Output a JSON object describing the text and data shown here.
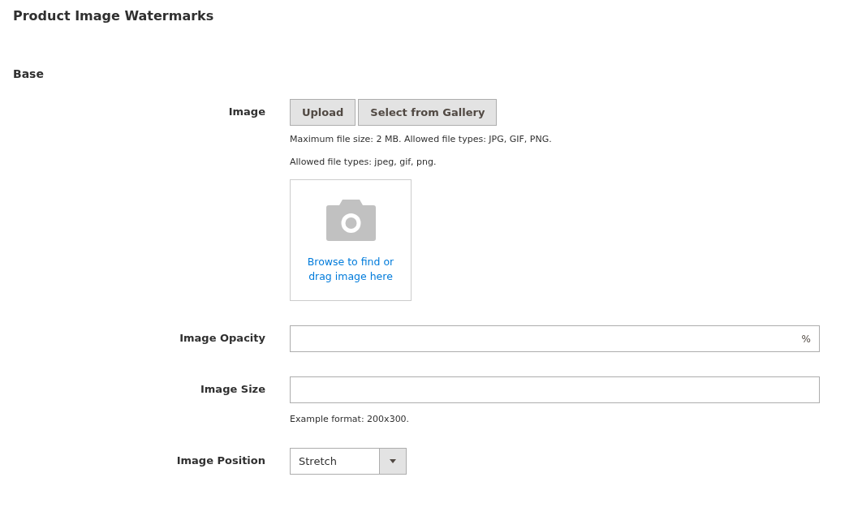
{
  "page_title": "Product Image Watermarks",
  "section_title": "Base",
  "fields": [
    {
      "kind": "upload",
      "label": "Image",
      "buttons": [
        "Upload",
        "Select from Gallery"
      ],
      "notes": [
        "Maximum file size: 2 MB. Allowed file types: JPG, GIF, PNG.",
        "Allowed file types: jpeg, gif, png."
      ],
      "dropzone_text": "Browse to find or drag image here"
    },
    {
      "kind": "text",
      "label": "Image Opacity",
      "suffix": "%"
    },
    {
      "kind": "text",
      "label": "Image Size",
      "note": "Example format: 200x300."
    },
    {
      "kind": "select",
      "label": "Image Position",
      "value": "Stretch"
    }
  ]
}
